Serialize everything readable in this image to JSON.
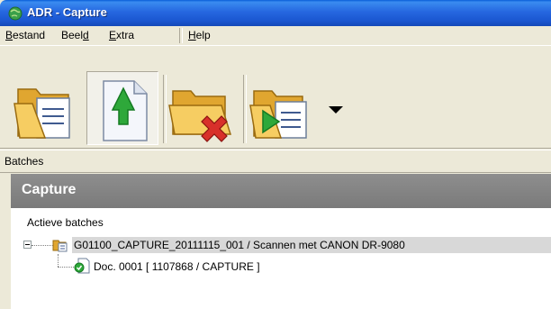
{
  "window": {
    "title": "ADR - Capture"
  },
  "menu": {
    "items": [
      {
        "pre": "",
        "acc": "B",
        "post": "estand"
      },
      {
        "pre": "Beel",
        "acc": "d",
        "post": ""
      },
      {
        "pre": "",
        "acc": "E",
        "post": "xtra"
      },
      {
        "pre": "",
        "acc": "H",
        "post": "elp"
      }
    ]
  },
  "toolbar": {
    "buttons": [
      {
        "icon": "open-batch-folder-icon",
        "pressed": false
      },
      {
        "icon": "upload-document-icon",
        "pressed": true
      },
      {
        "icon": "delete-folder-icon",
        "pressed": false
      },
      {
        "icon": "process-folder-icon",
        "pressed": false
      }
    ],
    "dropdown_icon": "triangle-down-icon"
  },
  "batches_bar": {
    "label": "Batches"
  },
  "panel": {
    "title": "Capture",
    "section_label": "Actieve batches",
    "tree": {
      "batch": "G01100_CAPTURE_20111115_001 / Scannen met CANON DR-9080",
      "document": "Doc. 0001 [ 1107868 / CAPTURE ]"
    }
  },
  "colors": {
    "titlebar": "#2667e0",
    "panel_header": "#7a7a7a",
    "selection": "#d8d8d8",
    "window_bg": "#ece9d8"
  }
}
